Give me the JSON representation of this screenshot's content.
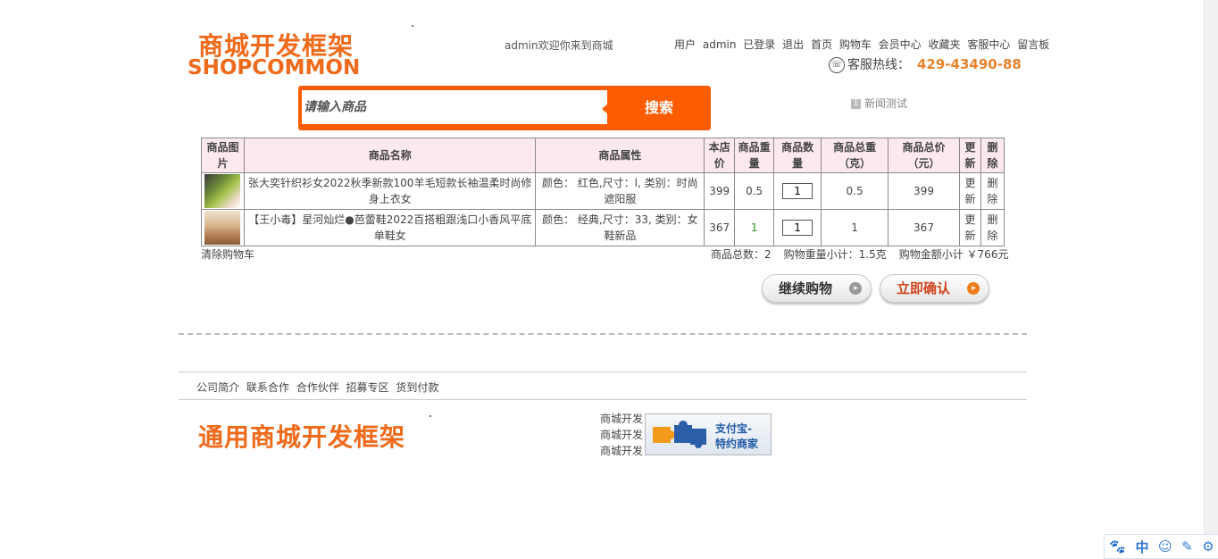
{
  "header": {
    "logo_cn": "商城开发框架",
    "logo_en": "SHOPCOMMON",
    "welcome": "admin欢迎你来到商城",
    "user_prefix": "用户",
    "username": "admin",
    "logged_in": "已登录",
    "nav": [
      "退出",
      "首页",
      "购物车",
      "会员中心",
      "收藏夹",
      "客服中心",
      "留言板"
    ],
    "hotline_label": "客服热线：",
    "hotline_number": "429-43490-88"
  },
  "search": {
    "placeholder": "请输入商品",
    "button": "搜索"
  },
  "news": {
    "badge": "1",
    "text": "新闻测试"
  },
  "cart": {
    "headers": [
      "商品图片",
      "商品名称",
      "商品属性",
      "本店价",
      "商品重量",
      "商品数量",
      "商品总重（克）",
      "商品总价（元）",
      "更新",
      "删除"
    ],
    "rows": [
      {
        "name": "张大奕针织衫女2022秋季新款100羊毛短款长袖温柔时尚修身上衣女",
        "attrs": "颜色： 红色,尺寸：l, 类别：时尚遮阳服",
        "price": "399",
        "weight": "0.5",
        "qty": "1",
        "total_weight": "0.5",
        "total_price": "399",
        "update": "更新",
        "delete": "删除"
      },
      {
        "name": "【王小毒】星河灿烂●芭蕾鞋2022百搭粗跟浅口小香风平底单鞋女",
        "attrs": "颜色： 经典,尺寸：33, 类别：女鞋新品",
        "price": "367",
        "weight": "1",
        "qty": "1",
        "total_weight": "1",
        "total_price": "367",
        "update": "更新",
        "delete": "删除"
      }
    ],
    "clear": "清除购物车",
    "summary": {
      "count": "商品总数：2",
      "weight": "购物重量小计：1.5克",
      "amount": "购物金额小计 ￥766元"
    }
  },
  "actions": {
    "continue": "继续购物",
    "confirm": "立即确认"
  },
  "footer": {
    "nav": [
      "公司简介",
      "联系合作",
      "合作伙伴",
      "招募专区",
      "货到付款"
    ],
    "logo": "通用商城开发框架",
    "links": [
      "商城开发",
      "商城开发",
      "商城开发"
    ],
    "alipay_line1": "支付宝-",
    "alipay_line2": "特约商家"
  },
  "ime": {
    "items": [
      "🐾",
      "中",
      "☺",
      "✎",
      "⚙"
    ]
  },
  "colors": {
    "brand_orange": "#ef6a1a",
    "search_orange": "#fd5c00",
    "table_header_bg": "#fbe9ee"
  }
}
